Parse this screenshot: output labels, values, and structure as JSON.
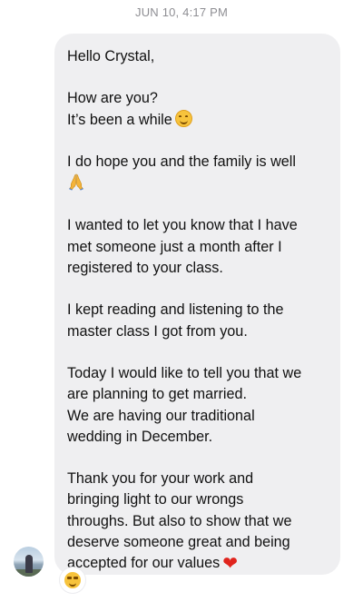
{
  "conversation": {
    "timestamp": "JUN 10, 4:17 PM"
  },
  "message": {
    "p1": "Hello Crystal,",
    "p2_line1": "How are you?",
    "p2_line2": "It’s been a while",
    "p2_emoji": "smiling-face",
    "p3_text": "I do hope you and the family is well",
    "p3_emoji": "folded-hands",
    "p4": "I wanted to let you know that I have\nmet someone just a month after I\nregistered to your class.",
    "p5": "I kept reading and listening to the\nmaster class I got from you.",
    "p6": "Today I would like to tell you that we\nare planning to get married.\nWe are having our traditional\nwedding in December.",
    "p7_text": "Thank you for your work and\nbringing light to our wrongs\nthroughs. But also to show that we\ndeserve someone great and being\naccepted for our values",
    "p7_emoji": "red-heart",
    "heart_glyph": "❤",
    "reaction_emoji": "smiling-face-with-sunglasses",
    "colors": {
      "bubble": "#efeff1",
      "timestamp": "#8e8e93",
      "heart": "#e0241d"
    }
  }
}
